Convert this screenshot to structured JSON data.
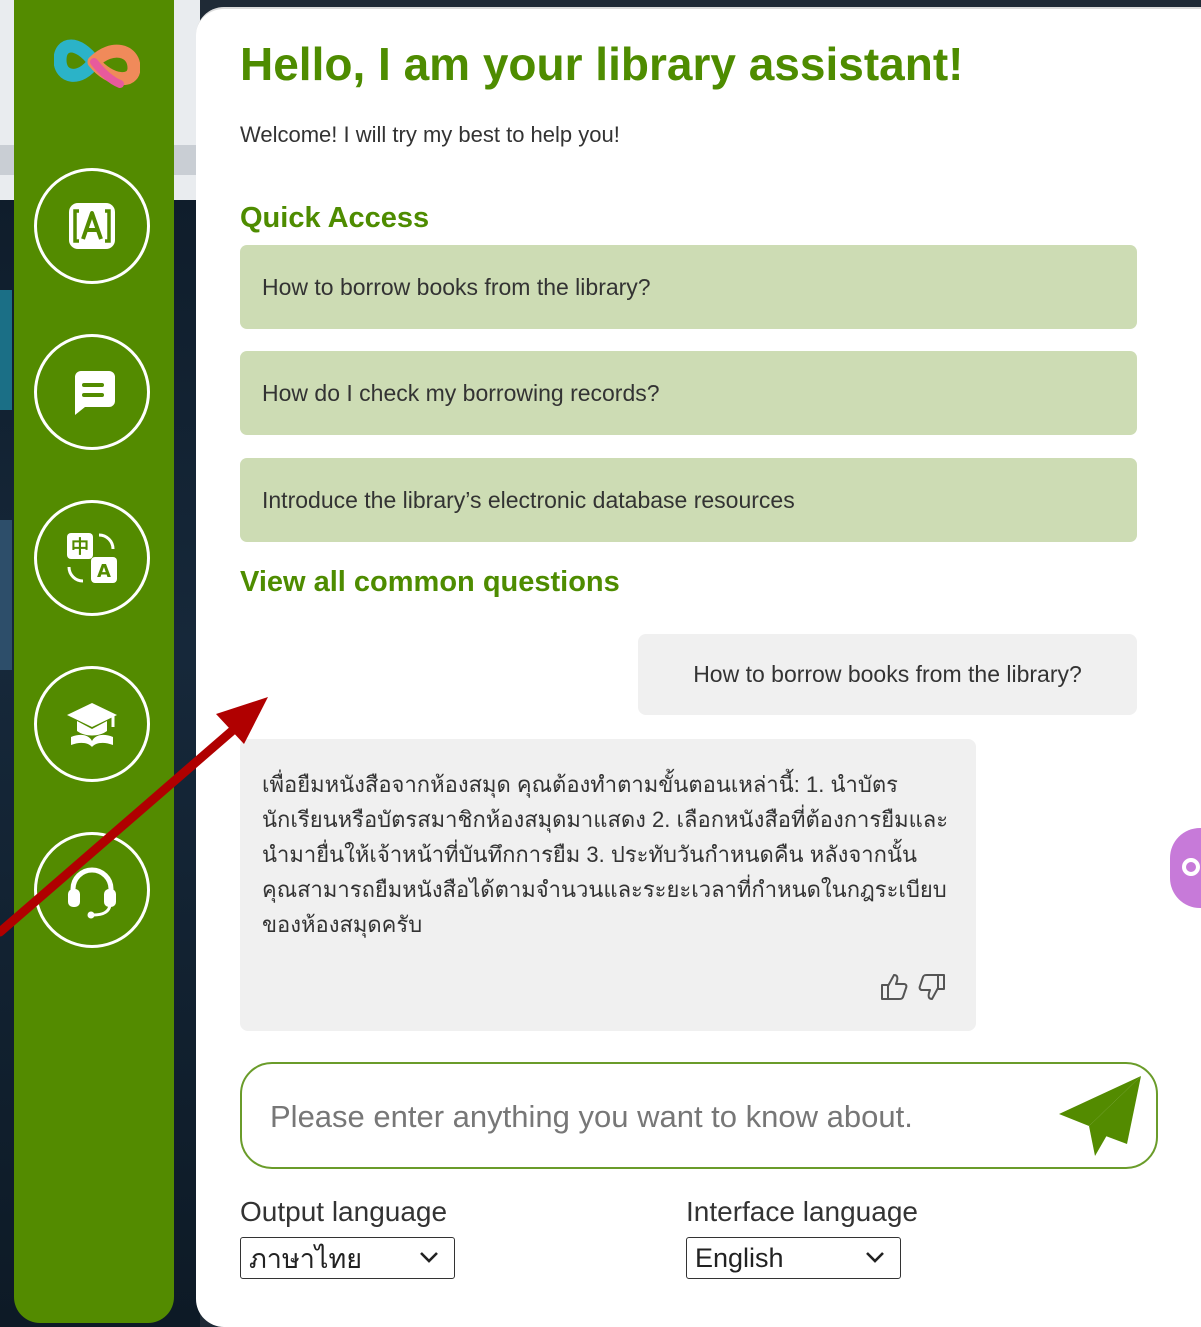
{
  "header": {
    "title": "Hello, I am your library assistant!",
    "subtitle": "Welcome! I will try my best to help you!"
  },
  "sidebar": {
    "items": [
      {
        "icon": "logo-icon"
      },
      {
        "icon": "text-recognition-icon"
      },
      {
        "icon": "chat-icon"
      },
      {
        "icon": "translate-icon"
      },
      {
        "icon": "graduation-cap-icon"
      },
      {
        "icon": "headset-icon"
      }
    ]
  },
  "quick_access": {
    "title": "Quick Access",
    "items": [
      "How to borrow books from the library?",
      "How do I check my borrowing records?",
      "Introduce the library’s electronic database resources"
    ],
    "view_all": "View all common questions"
  },
  "chat": {
    "user_message": "How to borrow books from the library?",
    "bot_message": "เพื่อยืมหนังสือจากห้องสมุด คุณต้องทำตามขั้นตอนเหล่านี้: 1. นำบัตรนักเรียนหรือบัตรสมาชิกห้องสมุดมาแสดง 2. เลือกหนังสือที่ต้องการยืมและนำมายื่นให้เจ้าหน้าที่บันทึกการยืม 3. ประทับวันกำหนดคืน หลังจากนั้น คุณสามารถยืมหนังสือได้ตามจำนวนและระยะเวลาที่กำหนดในกฎระเบียบของห้องสมุดครับ"
  },
  "input": {
    "placeholder": "Please enter anything you want to know about.",
    "value": ""
  },
  "languages": {
    "output_label": "Output language",
    "output_value": "ภาษาไทย",
    "interface_label": "Interface language",
    "interface_value": "English"
  },
  "colors": {
    "accent": "#538b00",
    "quick_bg": "#cddcb4",
    "bubble_bg": "#f0f0f0"
  }
}
